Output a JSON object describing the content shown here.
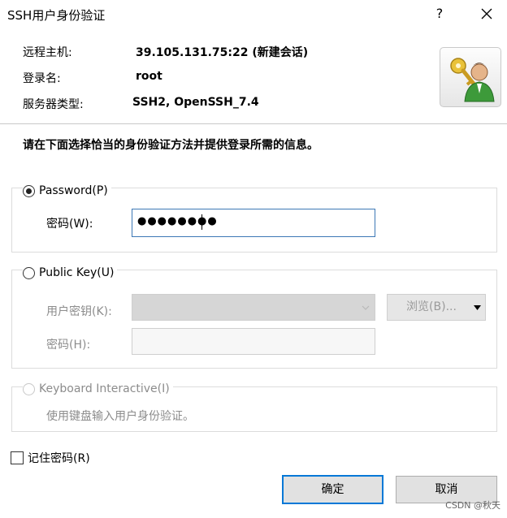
{
  "window": {
    "title": "SSH用户身份验证",
    "help_label": "?",
    "close_icon": "close-icon"
  },
  "info": {
    "host_label": "远程主机:",
    "host_value": "39.105.131.75:22 (新建会话)",
    "login_label": "登录名:",
    "login_value": "root",
    "server_label": "服务器类型:",
    "server_value": "SSH2, OpenSSH_7.4",
    "avatar_icon": "user-key-icon"
  },
  "instruction": "请在下面选择恰当的身份验证方法并提供登录所需的信息。",
  "password_group": {
    "radio_label": "Password(P)",
    "selected": true,
    "field_label": "密码(W):",
    "field_value": "●●●●●●●●"
  },
  "publickey_group": {
    "radio_label": "Public Key(U)",
    "selected": false,
    "key_label": "用户密钥(K):",
    "browse_label": "浏览(B)...",
    "passphrase_label": "密码(H):"
  },
  "keyboard_group": {
    "radio_label": "Keyboard Interactive(I)",
    "description": "使用键盘输入用户身份验证。"
  },
  "remember": {
    "label": "记住密码(R)",
    "checked": false
  },
  "buttons": {
    "ok_label": "确定",
    "cancel_label": "取消"
  },
  "watermark": "CSDN @秋天",
  "colors": {
    "accent": "#0078d7",
    "focus_border": "#3c78b5",
    "disabled_fill": "#d6d6d6"
  }
}
